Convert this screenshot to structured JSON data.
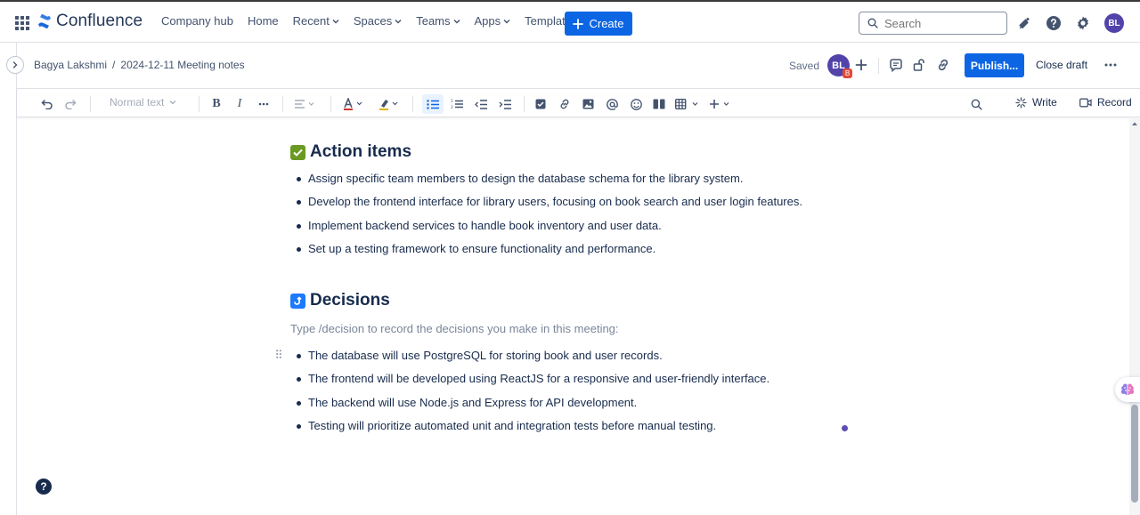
{
  "app": {
    "name": "Confluence"
  },
  "nav": {
    "items": [
      {
        "label": "Company hub",
        "dropdown": false
      },
      {
        "label": "Home",
        "dropdown": false
      },
      {
        "label": "Recent",
        "dropdown": true
      },
      {
        "label": "Spaces",
        "dropdown": true
      },
      {
        "label": "Teams",
        "dropdown": true
      },
      {
        "label": "Apps",
        "dropdown": true
      },
      {
        "label": "Templates",
        "dropdown": false
      }
    ],
    "create_label": "Create",
    "search_placeholder": "Search",
    "user_initials": "BL"
  },
  "breadcrumb": {
    "space": "Bagya Lakshmi",
    "separator": "/",
    "page": "2024-12-11 Meeting notes"
  },
  "page_header": {
    "status": "Saved",
    "collaborator_initials": "BL",
    "collaborator_badge": "B",
    "publish_label": "Publish...",
    "close_draft_label": "Close draft"
  },
  "toolbar": {
    "text_style": "Normal text",
    "write_label": "Write",
    "record_label": "Record"
  },
  "content": {
    "action_items": {
      "heading": "Action items",
      "items": [
        "Assign specific team members to design the database schema for the library system.",
        "Develop the frontend interface for library users, focusing on book search and user login features.",
        "Implement backend services to handle book inventory and user data.",
        "Set up a testing framework to ensure functionality and performance."
      ]
    },
    "decisions": {
      "heading": "Decisions",
      "placeholder": "Type /decision to record the decisions you make in this meeting:",
      "items": [
        "The database will use PostgreSQL for storing book and user records.",
        "The frontend will be developed using ReactJS for a responsive and user-friendly interface.",
        "The backend will use Node.js and Express for API development.",
        "Testing will prioritize automated unit and integration tests before manual testing."
      ]
    }
  },
  "colors": {
    "brand_blue": "#0c66e4",
    "avatar_purple": "#5243aa",
    "checkbox_green": "#6a9a23",
    "decision_blue": "#1d7afc"
  }
}
